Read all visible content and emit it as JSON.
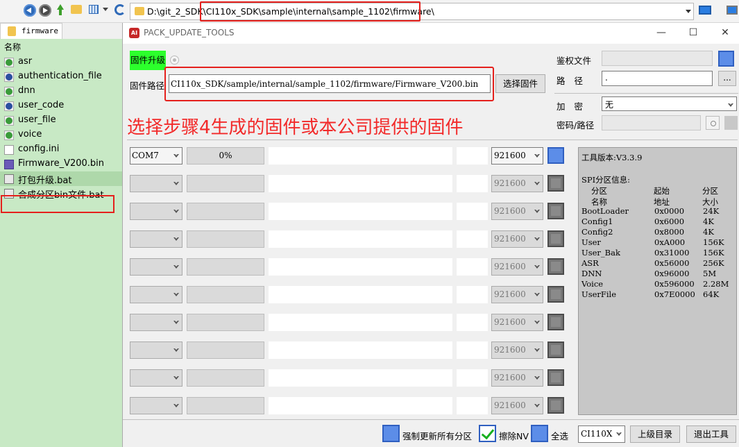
{
  "explorer": {
    "address_path": "D:\\git_2_SDK\\CI110x_SDK\\sample\\internal\\sample_1102\\firmware\\",
    "tab_label": "firmware",
    "column_name": "名称",
    "files": [
      {
        "name": "asr",
        "icon": "green-folder-icon"
      },
      {
        "name": "authentication_file",
        "icon": "blue-folder-icon"
      },
      {
        "name": "dnn",
        "icon": "green-folder-icon"
      },
      {
        "name": "user_code",
        "icon": "blue-folder-icon"
      },
      {
        "name": "user_file",
        "icon": "green-folder-icon"
      },
      {
        "name": "voice",
        "icon": "green-folder-icon"
      },
      {
        "name": "config.ini",
        "icon": "ini-file-icon"
      },
      {
        "name": "Firmware_V200.bin",
        "icon": "hex-file-icon"
      },
      {
        "name": "打包升级.bat",
        "icon": "bat-file-icon"
      },
      {
        "name": "合成分区bin文件.bat",
        "icon": "bat-file-icon"
      }
    ]
  },
  "tool": {
    "title": "PACK_UPDATE_TOOLS",
    "minimize": "—",
    "maximize": "☐",
    "close": "✕",
    "upgrade_label": "固件升级",
    "path_label": "固件路径",
    "path_value": "CI110x_SDK/sample/internal/sample_1102/firmware/Firmware_V200.bin",
    "select_button": "选择固件",
    "instruction": "选择步骤4生成的固件或本公司提供的固件",
    "auth_label": "鉴权文件",
    "route_label": "路径",
    "route_value": ".",
    "dots_button": "...",
    "encrypt_label": "加密",
    "encrypt_value": "无",
    "password_label": "密码/路径",
    "ports": [
      {
        "com": "COM7",
        "progress": "0%",
        "baud": "921600",
        "active": true
      },
      {
        "com": "",
        "progress": "",
        "baud": "921600",
        "active": false
      },
      {
        "com": "",
        "progress": "",
        "baud": "921600",
        "active": false
      },
      {
        "com": "",
        "progress": "",
        "baud": "921600",
        "active": false
      },
      {
        "com": "",
        "progress": "",
        "baud": "921600",
        "active": false
      },
      {
        "com": "",
        "progress": "",
        "baud": "921600",
        "active": false
      },
      {
        "com": "",
        "progress": "",
        "baud": "921600",
        "active": false
      },
      {
        "com": "",
        "progress": "",
        "baud": "921600",
        "active": false
      },
      {
        "com": "",
        "progress": "",
        "baud": "921600",
        "active": false
      },
      {
        "com": "",
        "progress": "",
        "baud": "921600",
        "active": false
      }
    ],
    "info": {
      "version": "工具版本:V3.3.9",
      "spi_title": "SPI分区信息:",
      "headers": [
        [
          "分区",
          "名称"
        ],
        [
          "起始",
          "地址"
        ],
        [
          "分区",
          "大小"
        ]
      ],
      "partitions": [
        [
          "BootLoader",
          "0x0000",
          "24K"
        ],
        [
          "Config1",
          "0x6000",
          "4K"
        ],
        [
          "Config2",
          "0x8000",
          "4K"
        ],
        [
          "User",
          "0xA000",
          "156K"
        ],
        [
          "User_Bak",
          "0x31000",
          "156K"
        ],
        [
          "ASR",
          "0x56000",
          "256K"
        ],
        [
          "DNN",
          "0x96000",
          "5M"
        ],
        [
          "Voice",
          "0x596000",
          "2.28M"
        ],
        [
          "UserFile",
          "0x7E0000",
          "64K"
        ]
      ]
    },
    "bottom": {
      "force_update": "强制更新所有分区",
      "erase_nv": "擦除NV",
      "select_all": "全选",
      "chip": "CI110X",
      "parent_dir": "上级目录",
      "exit": "退出工具"
    }
  }
}
